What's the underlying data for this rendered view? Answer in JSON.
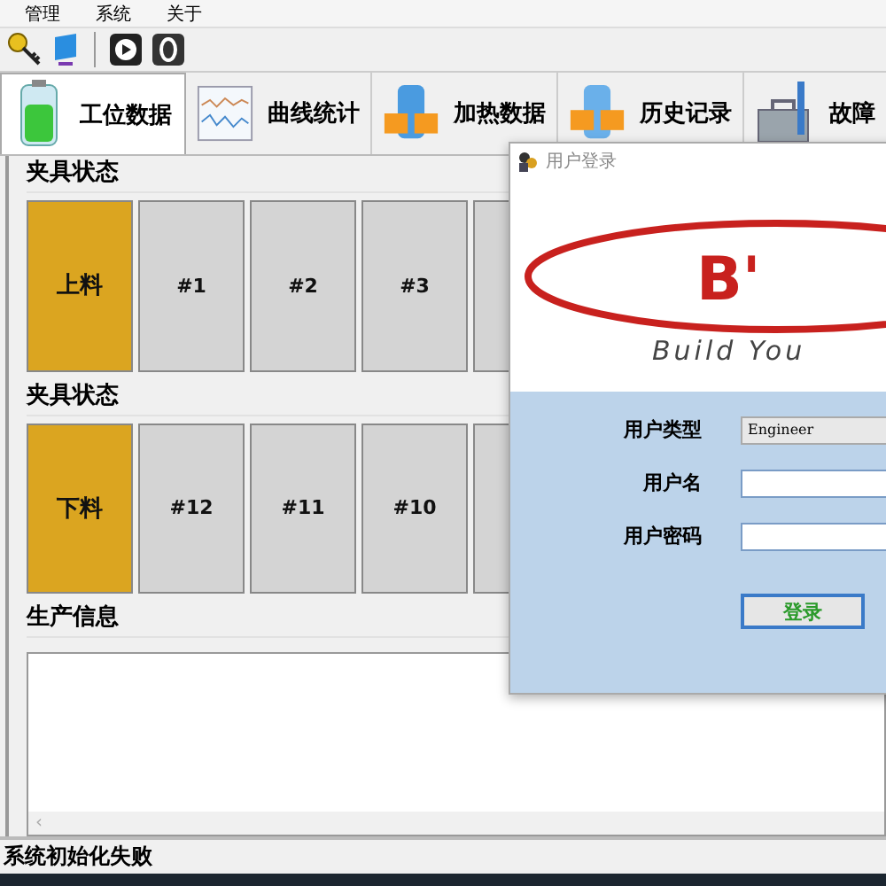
{
  "menu": [
    "管理",
    "系统",
    "关于"
  ],
  "toolbar": [
    {
      "kind": "key"
    },
    {
      "kind": "monitor"
    },
    {
      "kind": "separator"
    },
    {
      "kind": "play"
    },
    {
      "kind": "stop"
    }
  ],
  "tabs": [
    {
      "label": "工位数据",
      "selected": true
    },
    {
      "label": "曲线统计",
      "selected": false
    },
    {
      "label": "加热数据",
      "selected": false
    },
    {
      "label": "历史记录",
      "selected": false
    },
    {
      "label": "故障",
      "selected": false
    }
  ],
  "fixture_rows": [
    {
      "title": "夹具状态",
      "slots": [
        {
          "kind": "load",
          "label": "上料"
        },
        {
          "kind": "station",
          "label": "#1"
        },
        {
          "kind": "station",
          "label": "#2"
        },
        {
          "kind": "station",
          "label": "#3"
        },
        {
          "kind": "station"
        }
      ]
    },
    {
      "title": "夹具状态",
      "slots": [
        {
          "kind": "load",
          "label": "下料"
        },
        {
          "kind": "station",
          "label": "#12"
        },
        {
          "kind": "station",
          "label": "#11"
        },
        {
          "kind": "station",
          "label": "#10"
        },
        {
          "kind": "station"
        }
      ]
    }
  ],
  "production_info": {
    "title": "生产信息",
    "scroll_left": "‹"
  },
  "status_bar": "系统初始化失败",
  "login_dialog": {
    "title": "用户登录",
    "logo_mark": "B'",
    "tagline": "Build You",
    "fields": [
      {
        "kind": "select",
        "label": "用户类型",
        "value": "Engineer"
      },
      {
        "kind": "input",
        "label": "用户名"
      },
      {
        "kind": "input",
        "label": "用户密码"
      }
    ],
    "button": "登录"
  }
}
